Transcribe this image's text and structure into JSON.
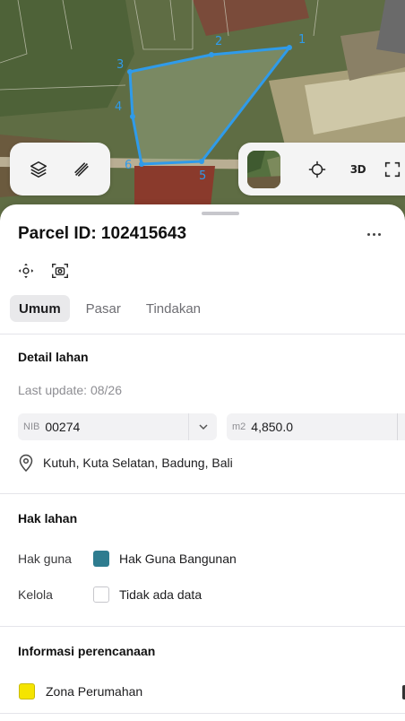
{
  "map": {
    "parcel_vertex_labels": [
      "1",
      "2",
      "3",
      "4",
      "5",
      "6"
    ],
    "buttons": {
      "layers": "layers-icon",
      "measure": "measure-icon",
      "thumbnail": "satellite-thumbnail",
      "locate": "crosshair-icon",
      "three_d": "3D",
      "more": "expand-icon"
    }
  },
  "parcel": {
    "title": "Parcel ID: 102415643"
  },
  "tabs": [
    {
      "label": "Umum",
      "active": true
    },
    {
      "label": "Pasar",
      "active": false
    },
    {
      "label": "Tindakan",
      "active": false
    }
  ],
  "detail": {
    "title": "Detail lahan",
    "last_update": "Last update: 08/26",
    "nib_prefix": "NIB",
    "nib_value": "00274",
    "area_prefix": "m2",
    "area_value": "4,850.0",
    "location": "Kutuh, Kuta Selatan, Badung, Bali"
  },
  "hak": {
    "title": "Hak lahan",
    "rows": [
      {
        "label": "Hak guna",
        "value": "Hak Guna Bangunan",
        "color": "#2e7c8f"
      },
      {
        "label": "Kelola",
        "value": "Tidak ada data",
        "color": "#ffffff"
      }
    ]
  },
  "planning": {
    "title": "Informasi perencanaan",
    "zone_label": "Zona Perumahan",
    "zone_color": "#f5e400"
  },
  "colors": {
    "parcel_outline": "#2f9bea",
    "tab_active_bg": "#e9e9eb"
  }
}
